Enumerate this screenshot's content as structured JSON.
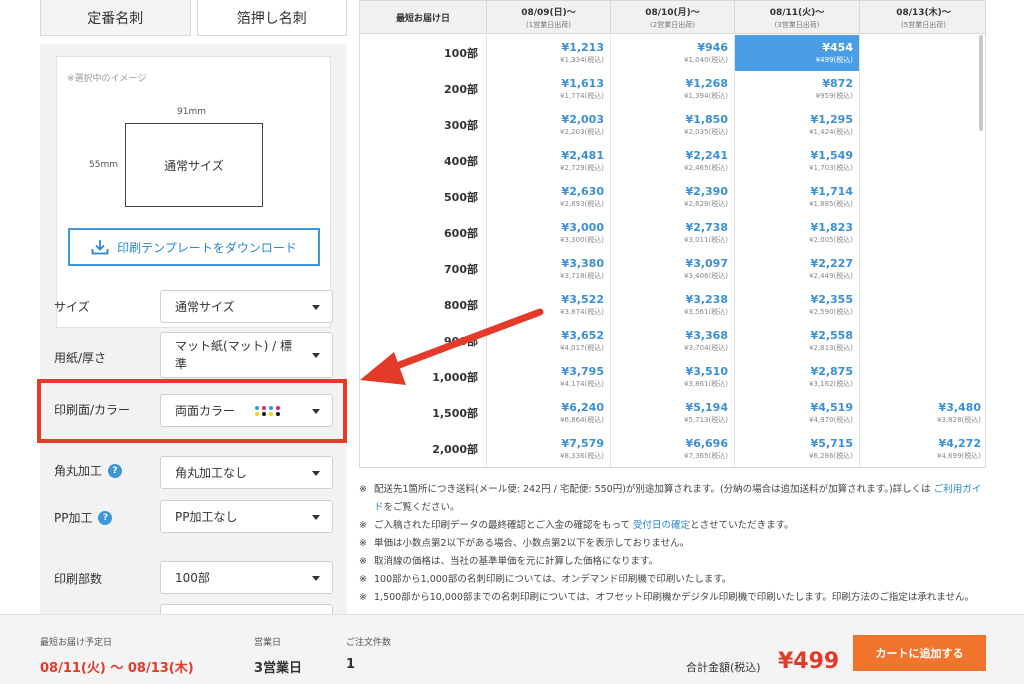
{
  "tabs": [
    {
      "label": "定番名刺"
    },
    {
      "label": "箔押し名刺"
    }
  ],
  "preview": {
    "note": "※選択中のイメージ",
    "width_label": "91mm",
    "height_label": "55mm",
    "card_label": "通常サイズ",
    "download_label": "印刷テンプレートをダウンロード"
  },
  "options": [
    {
      "label": "サイズ",
      "value": "通常サイズ"
    },
    {
      "label": "用紙/厚さ",
      "value": "マット紙(マット) / 標準"
    },
    {
      "label": "印刷面/カラー",
      "value": "両面カラー"
    },
    {
      "label": "角丸加工",
      "value": "角丸加工なし"
    },
    {
      "label": "PP加工",
      "value": "PP加工なし"
    },
    {
      "label": "印刷部数",
      "value": "100部"
    }
  ],
  "table": {
    "corner_label": "最短お届け日",
    "columns": [
      {
        "date": "08/09(日)〜",
        "sub": "(1営業日出荷)"
      },
      {
        "date": "08/10(月)〜",
        "sub": "(2営業日出荷)"
      },
      {
        "date": "08/11(火)〜",
        "sub": "(3営業日出荷)"
      },
      {
        "date": "08/13(木)〜",
        "sub": "(5営業日出荷)"
      }
    ],
    "rows": [
      {
        "qty": "100部",
        "cells": [
          {
            "p": "¥1,213",
            "t": "¥1,334(税込)"
          },
          {
            "p": "¥946",
            "t": "¥1,040(税込)"
          },
          {
            "p": "¥454",
            "t": "¥499(税込)"
          },
          null
        ]
      },
      {
        "qty": "200部",
        "cells": [
          {
            "p": "¥1,613",
            "t": "¥1,774(税込)"
          },
          {
            "p": "¥1,268",
            "t": "¥1,394(税込)"
          },
          {
            "p": "¥872",
            "t": "¥959(税込)"
          },
          null
        ]
      },
      {
        "qty": "300部",
        "cells": [
          {
            "p": "¥2,003",
            "t": "¥2,203(税込)"
          },
          {
            "p": "¥1,850",
            "t": "¥2,035(税込)"
          },
          {
            "p": "¥1,295",
            "t": "¥1,424(税込)"
          },
          null
        ]
      },
      {
        "qty": "400部",
        "cells": [
          {
            "p": "¥2,481",
            "t": "¥2,729(税込)"
          },
          {
            "p": "¥2,241",
            "t": "¥2,465(税込)"
          },
          {
            "p": "¥1,549",
            "t": "¥1,703(税込)"
          },
          null
        ]
      },
      {
        "qty": "500部",
        "cells": [
          {
            "p": "¥2,630",
            "t": "¥2,893(税込)"
          },
          {
            "p": "¥2,390",
            "t": "¥2,629(税込)"
          },
          {
            "p": "¥1,714",
            "t": "¥1,885(税込)"
          },
          null
        ]
      },
      {
        "qty": "600部",
        "cells": [
          {
            "p": "¥3,000",
            "t": "¥3,300(税込)"
          },
          {
            "p": "¥2,738",
            "t": "¥3,011(税込)"
          },
          {
            "p": "¥1,823",
            "t": "¥2,005(税込)"
          },
          null
        ]
      },
      {
        "qty": "700部",
        "cells": [
          {
            "p": "¥3,380",
            "t": "¥3,718(税込)"
          },
          {
            "p": "¥3,097",
            "t": "¥3,406(税込)"
          },
          {
            "p": "¥2,227",
            "t": "¥2,449(税込)"
          },
          null
        ]
      },
      {
        "qty": "800部",
        "cells": [
          {
            "p": "¥3,522",
            "t": "¥3,874(税込)"
          },
          {
            "p": "¥3,238",
            "t": "¥3,561(税込)"
          },
          {
            "p": "¥2,355",
            "t": "¥2,590(税込)"
          },
          null
        ]
      },
      {
        "qty": "900部",
        "cells": [
          {
            "p": "¥3,652",
            "t": "¥4,017(税込)"
          },
          {
            "p": "¥3,368",
            "t": "¥3,704(税込)"
          },
          {
            "p": "¥2,558",
            "t": "¥2,813(税込)"
          },
          null
        ]
      },
      {
        "qty": "1,000部",
        "cells": [
          {
            "p": "¥3,795",
            "t": "¥4,174(税込)"
          },
          {
            "p": "¥3,510",
            "t": "¥3,861(税込)"
          },
          {
            "p": "¥2,875",
            "t": "¥3,162(税込)"
          },
          null
        ]
      },
      {
        "qty": "1,500部",
        "cells": [
          {
            "p": "¥6,240",
            "t": "¥6,864(税込)"
          },
          {
            "p": "¥5,194",
            "t": "¥5,713(税込)"
          },
          {
            "p": "¥4,519",
            "t": "¥4,970(税込)"
          },
          {
            "p": "¥3,480",
            "t": "¥3,828(税込)"
          }
        ]
      },
      {
        "qty": "2,000部",
        "cells": [
          {
            "p": "¥7,579",
            "t": "¥8,336(税込)"
          },
          {
            "p": "¥6,696",
            "t": "¥7,365(税込)"
          },
          {
            "p": "¥5,715",
            "t": "¥6,286(税込)"
          },
          {
            "p": "¥4,272",
            "t": "¥4,699(税込)"
          }
        ]
      }
    ]
  },
  "notes": {
    "n1a": "配送先1箇所につき送料(メール便: 242円 / 宅配便: 550円)が別途加算されます。(分納の場合は追加送料が加算されます。)詳しくは ",
    "n1link": "ご利用ガイド",
    "n1b": "をご覧ください。",
    "n2a": "ご入稿された印刷データの最終確認とご入金の確認をもって ",
    "n2link": "受付日の確定",
    "n2b": "とさせていただきます。",
    "n3": "単価は小数点第2以下がある場合、小数点第2以下を表示しておりません。",
    "n4": "取消線の価格は、当社の基準単価を元に計算した価格になります。",
    "n5": "100部から1,000部の名刺印刷については、オンデマンド印刷機で印刷いたします。",
    "n6": "1,500部から10,000部までの名刺印刷については、オフセット印刷機かデジタル印刷機で印刷いたします。印刷方法のご指定は承れません。"
  },
  "bottom": {
    "delivery_label": "最短お届け予定日",
    "delivery_value": "08/11(火) 〜 08/13(木)",
    "days_label": "営業日",
    "days_value": "3営業日",
    "count_label": "ご注文件数",
    "count_value": "1",
    "total_label": "合計金額(税込)",
    "total_value": "¥499",
    "cart_label": "カートに追加する"
  },
  "colors": {
    "accent": "#3d97d9",
    "highlight": "#e33a2a",
    "cart": "#f0742b",
    "selected_cell": "#4a9ee6"
  }
}
